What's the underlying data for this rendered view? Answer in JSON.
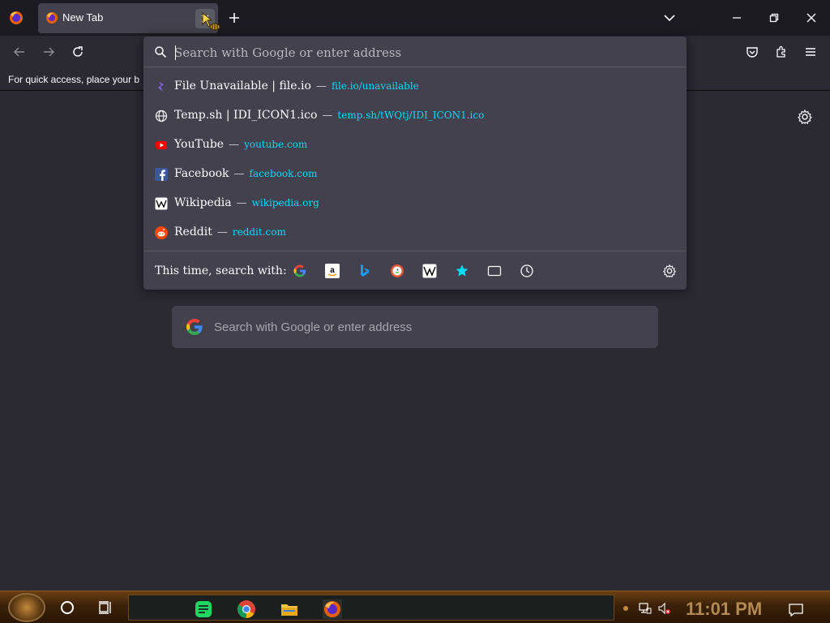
{
  "tab": {
    "title": "New Tab"
  },
  "bookmarks": {
    "hint": "For quick access, place your b"
  },
  "urlbar": {
    "placeholder": "Search with Google or enter address",
    "results": [
      {
        "title": "File Unavailable | file.io",
        "url": "file.io/unavailable",
        "icon": "file-io-icon"
      },
      {
        "title": "Temp.sh | IDI_ICON1.ico",
        "url": "temp.sh/tWQtj/IDI_ICON1.ico",
        "icon": "globe-icon"
      },
      {
        "title": "YouTube",
        "url": "youtube.com",
        "icon": "youtube-icon"
      },
      {
        "title": "Facebook",
        "url": "facebook.com",
        "icon": "facebook-icon"
      },
      {
        "title": "Wikipedia",
        "url": "wikipedia.org",
        "icon": "wikipedia-icon"
      },
      {
        "title": "Reddit",
        "url": "reddit.com",
        "icon": "reddit-icon"
      }
    ],
    "separator": "—",
    "oneoff_label": "This time, search with:",
    "oneoffs": [
      "google-icon",
      "amazon-icon",
      "bing-icon",
      "duckduckgo-icon",
      "wikipedia-icon",
      "bookmarks-star-icon",
      "tabs-icon",
      "history-icon"
    ]
  },
  "content_search": {
    "placeholder": "Search with Google or enter address"
  },
  "taskbar": {
    "clock": "11:01 PM"
  },
  "colors": {
    "accent": "#00ddff",
    "toolbar": "#2b2a33",
    "popup": "#42414d"
  }
}
